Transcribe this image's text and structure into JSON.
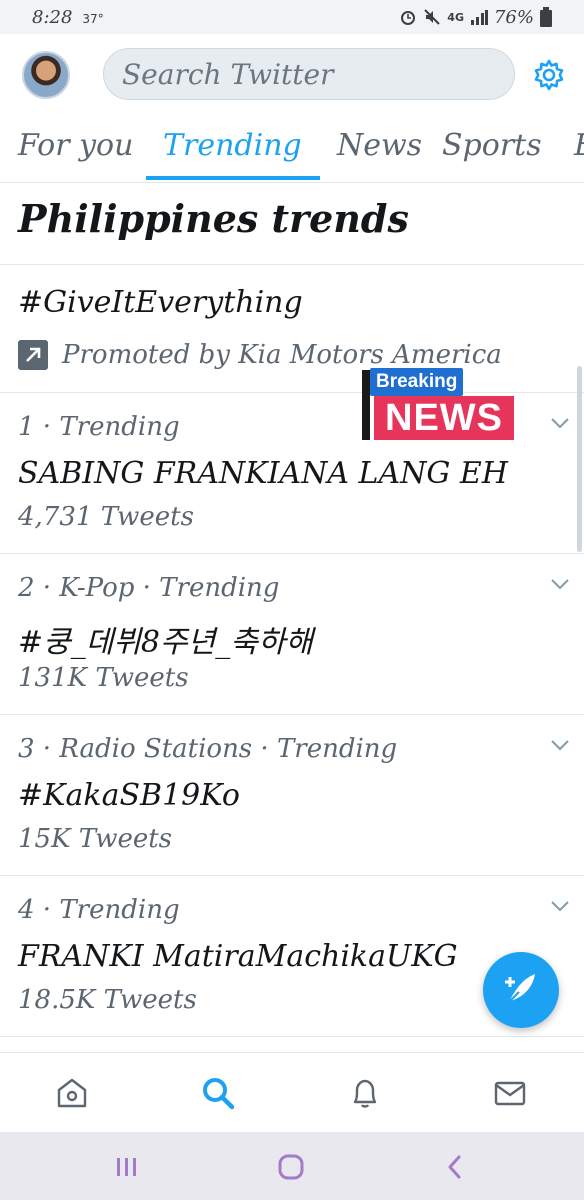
{
  "status": {
    "time": "8:28",
    "temp": "37°",
    "battery": "76%",
    "network": "4G"
  },
  "header": {
    "search_placeholder": "Search Twitter"
  },
  "tabs": [
    {
      "label": "For you"
    },
    {
      "label": "Trending"
    },
    {
      "label": "News"
    },
    {
      "label": "Sports"
    },
    {
      "label": "E"
    }
  ],
  "section_title": "Philippines trends",
  "promoted": {
    "name": "#GiveItEverything",
    "label": "Promoted by Kia Motors America"
  },
  "overlay": {
    "breaking": "Breaking",
    "news": "NEWS"
  },
  "trends": [
    {
      "meta": "1 · Trending",
      "name": "SABING FRANKIANA LANG EH",
      "count": "4,731 Tweets"
    },
    {
      "meta": "2 · K-Pop · Trending",
      "name": "#쿵_데뷔8주년_축하해",
      "count": "131K Tweets"
    },
    {
      "meta": "3 · Radio Stations · Trending",
      "name": "#KakaSB19Ko",
      "count": "15K Tweets"
    },
    {
      "meta": "4 · Trending",
      "name": "FRANKI MatiraMachikaUKG",
      "count": "18.5K Tweets"
    }
  ],
  "colors": {
    "accent": "#1da1f2",
    "text": "#14171a",
    "secondary": "#5b6670"
  },
  "icons": {
    "settings": "gear-icon",
    "promoted": "promoted-arrow-icon",
    "compose": "compose-tweet-icon",
    "home": "home-icon",
    "search": "search-icon",
    "notifications": "bell-icon",
    "messages": "mail-icon"
  }
}
